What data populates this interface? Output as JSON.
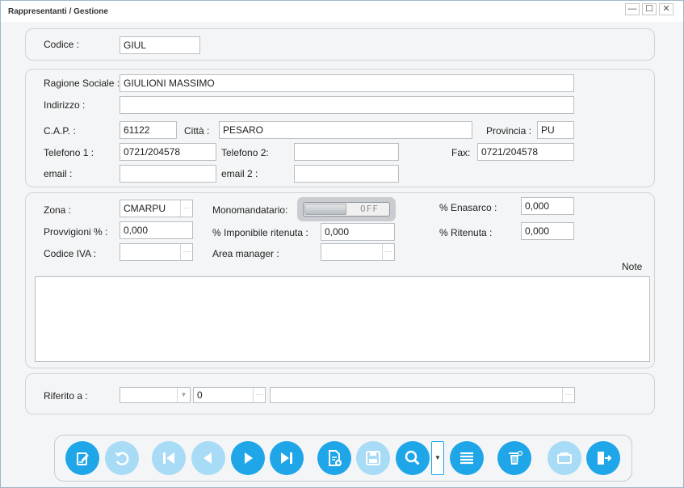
{
  "window": {
    "title": "Rappresentanti / Gestione",
    "controls": [
      "—",
      "☐",
      "✕"
    ]
  },
  "header": {
    "codice_label": "Codice :",
    "codice_value": "GIUL"
  },
  "anagrafica": {
    "ragione_sociale_label": "Ragione Sociale :",
    "ragione_sociale_value": "GIULIONI MASSIMO",
    "indirizzo_label": "Indirizzo :",
    "indirizzo_value": "",
    "cap_label": "C.A.P. :",
    "cap_value": "61122",
    "citta_label": "Città :",
    "citta_value": "PESARO",
    "provincia_label": "Provincia :",
    "provincia_value": "PU",
    "telefono1_label": "Telefono 1 :",
    "telefono1_value": "0721/204578",
    "telefono2_label": "Telefono 2:",
    "telefono2_value": "",
    "fax_label": "Fax:",
    "fax_value": "0721/204578",
    "email_label": "email :",
    "email_value": "",
    "email2_label": "email 2 :",
    "email2_value": ""
  },
  "dettagli": {
    "zona_label": "Zona :",
    "zona_value": "CMARPU",
    "monomandatario_label": "Monomandatario:",
    "monomandatario_state": "OFF",
    "enasarco_label": "% Enasarco :",
    "enasarco_value": "0,000",
    "provvigioni_label": "Provvigioni % :",
    "provvigioni_value": "0,000",
    "imponibile_label": "% Imponibile ritenuta :",
    "imponibile_value": "0,000",
    "ritenuta_label": "% Ritenuta :",
    "ritenuta_value": "0,000",
    "codice_iva_label": "Codice IVA :",
    "codice_iva_value": "",
    "area_manager_label": "Area manager :",
    "area_manager_value": "",
    "note_label": "Note",
    "note_value": ""
  },
  "riferimento": {
    "label": "Riferito a :",
    "select_value": "",
    "number_value": "0",
    "text_value": ""
  },
  "toolbar": {
    "accent": "#1ea6e8",
    "disabled": "#a8dbf5",
    "buttons": [
      "edit-icon",
      "undo-icon",
      "first-icon",
      "previous-icon",
      "next-icon",
      "last-icon",
      "new-document-icon",
      "save-icon",
      "search-icon",
      "list-icon",
      "delete-icon",
      "print-icon",
      "exit-icon"
    ]
  }
}
